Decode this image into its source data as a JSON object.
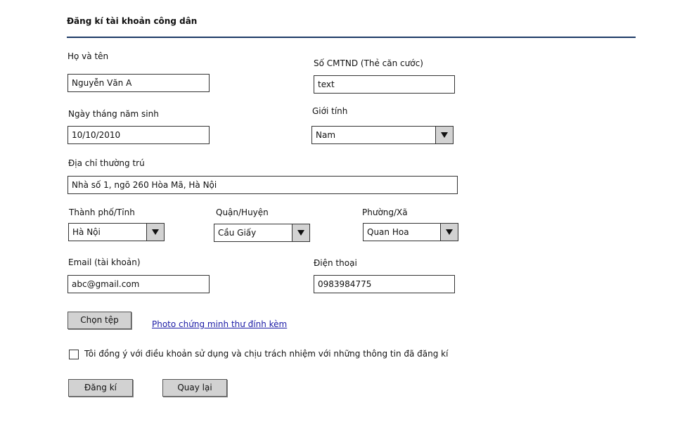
{
  "form": {
    "title": "Đăng kí tài khoản công dân",
    "full_name": {
      "label": "Họ và tên",
      "value": "Nguyễn Văn A"
    },
    "id_number": {
      "label": "Số CMTND (Thẻ căn cước)",
      "value": "text"
    },
    "birth_date": {
      "label": "Ngày tháng năm sinh",
      "value": "10/10/2010"
    },
    "gender": {
      "label": "Giới tính",
      "value": "Nam"
    },
    "address": {
      "label": "Địa chỉ thường trú",
      "value": "Nhà số 1, ngõ 260 Hòa Mã, Hà Nội"
    },
    "city": {
      "label": "Thành phố/Tỉnh",
      "value": "Hà Nội"
    },
    "district": {
      "label": "Quận/Huyện",
      "value": "Cầu Giấy"
    },
    "ward": {
      "label": "Phường/Xã",
      "value": "Quan Hoa"
    },
    "email": {
      "label": "Email (tài khoản)",
      "value": "abc@gmail.com"
    },
    "phone": {
      "label": "Điện thoại",
      "value": "0983984775"
    },
    "file_button": "Chọn tệp",
    "attachment_link": "Photo chứng minh thư đính kèm",
    "terms_checkbox": {
      "label": "Tôi đồng ý với điều khoản sử dụng và chịu trách nhiệm với những thông tin đã đăng kí",
      "checked": false
    },
    "register_button": "Đăng kí",
    "back_button": "Quay lại"
  },
  "colors": {
    "rule": "#1d3a66",
    "button_bg": "#d2d2d2",
    "link": "#1a1aa6"
  },
  "icons": {
    "dropdown": "triangle-down-icon"
  }
}
